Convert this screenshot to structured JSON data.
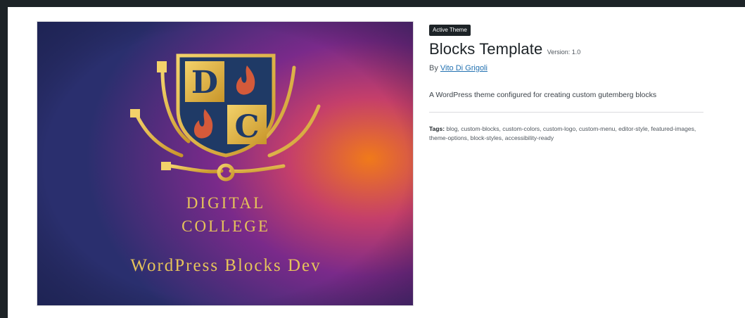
{
  "theme": {
    "badge": "Active Theme",
    "name": "Blocks Template",
    "version_label": "Version: 1.0",
    "by_label": "By",
    "author": "Vito Di Grigoli",
    "description": "A WordPress theme configured for creating custom gutemberg blocks",
    "tags_label": "Tags:",
    "tags": "blog, custom-blocks, custom-colors, custom-logo, custom-menu, editor-style, featured-images, theme-options, block-styles, accessibility-ready"
  },
  "screenshot": {
    "crest_letters": [
      "D",
      "C"
    ],
    "line1": "DIGITAL",
    "line2": "COLLEGE",
    "line3": "WordPress Blocks Dev"
  },
  "colors": {
    "page_bg": "#1d2327",
    "link": "#2271b1",
    "gold": "#e0b83f",
    "navy": "#1f3a66"
  }
}
